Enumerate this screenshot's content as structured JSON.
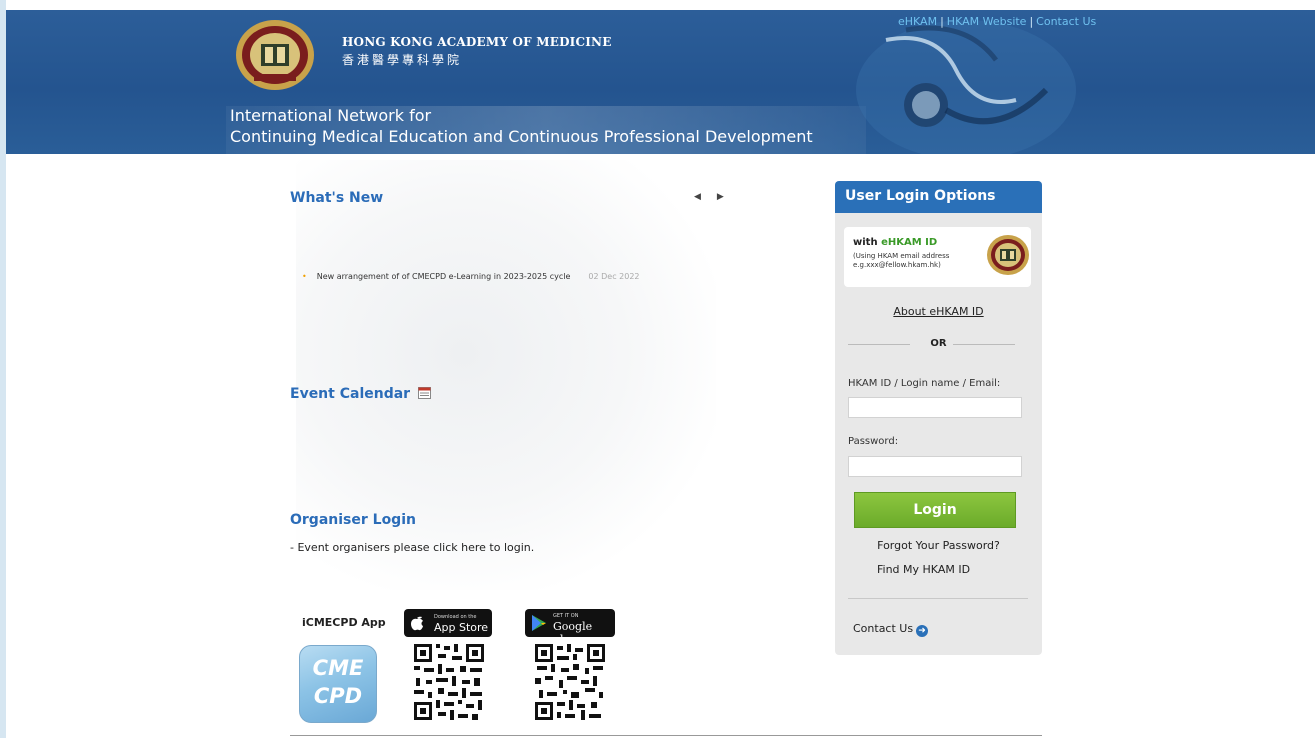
{
  "header": {
    "org_name_en": "HONG KONG ACADEMY OF MEDICINE",
    "org_name_zh": "香港醫學專科學院",
    "tagline_line1": "International Network for",
    "tagline_line2": "Continuing Medical Education and Continuous Professional Development",
    "links": [
      "eHKAM",
      "HKAM Website",
      "Contact Us"
    ],
    "link_separator": "|"
  },
  "whats_new": {
    "title": "What's New",
    "items": [
      {
        "text": "New arrangement of of CMECPD e-Learning in 2023-2025 cycle",
        "date": "02 Dec 2022"
      }
    ]
  },
  "event_calendar": {
    "title": "Event Calendar"
  },
  "organiser": {
    "title": "Organiser Login",
    "note": "- Event organisers please click here to login."
  },
  "app": {
    "label": "iCMECPD App",
    "icon_text_1": "CME",
    "icon_text_2": "CPD",
    "appstore_small": "Download on the",
    "appstore_big": "App Store",
    "googleplay_small": "GET IT ON",
    "googleplay_big": "Google play"
  },
  "login": {
    "title": "User Login Options",
    "ehkam_with": "with",
    "ehkam_id": "eHKAM ID",
    "ehkam_note1": "(Using HKAM email address",
    "ehkam_note2": "e.g.xxx@fellow.hkam.hk)",
    "about_link": "About eHKAM ID",
    "or": "OR",
    "id_label": "HKAM ID / Login name / Email:",
    "password_label": "Password:",
    "login_button": "Login",
    "forgot_link": "Forgot Your Password?",
    "find_id_link": "Find My HKAM ID",
    "contact_link": "Contact Us"
  },
  "colors": {
    "header_blue": "#24548f",
    "section_title": "#2b6cb8",
    "login_green": "#7ab834",
    "panel_head": "#2a70b8"
  }
}
